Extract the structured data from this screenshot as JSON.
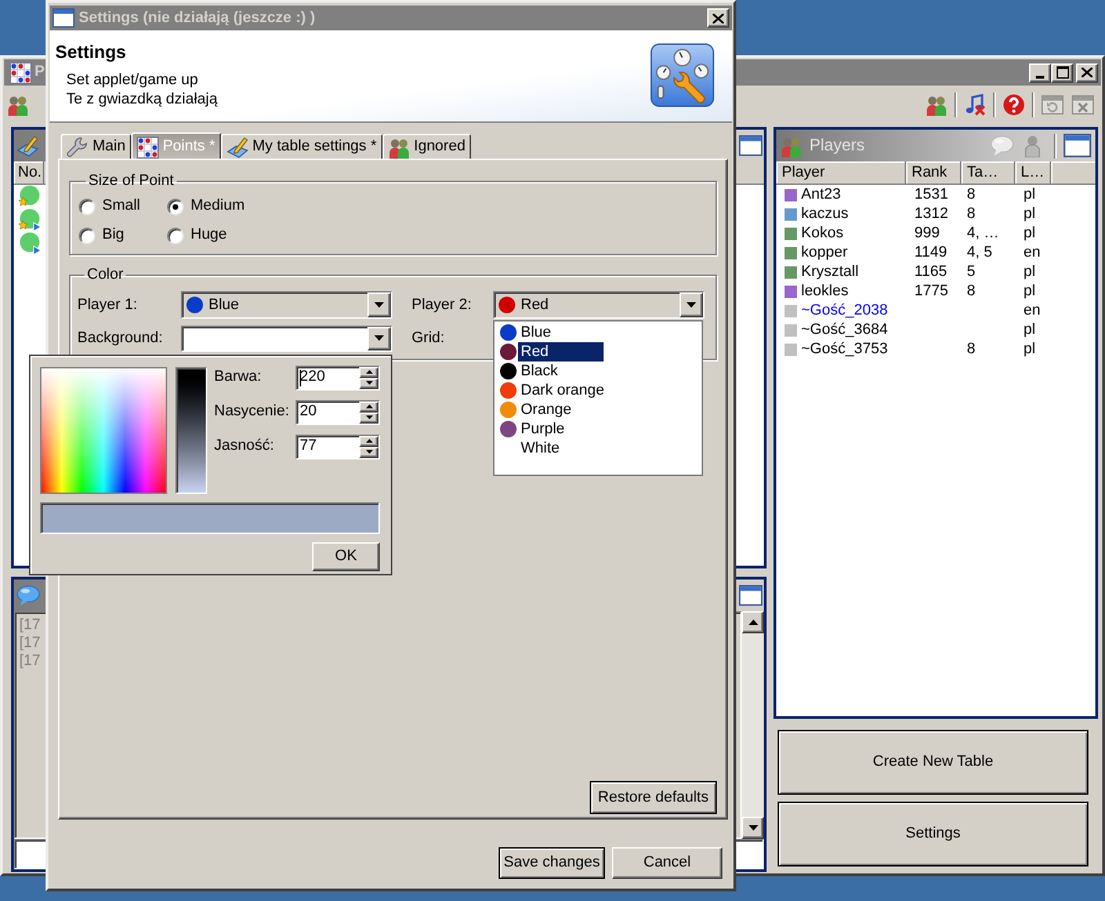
{
  "main_window": {
    "title": "P",
    "toolbar_left": [
      {
        "kind": "users",
        "disabled": false
      }
    ],
    "toolbar_right": [
      {
        "kind": "users",
        "disabled": false
      },
      {
        "kind": "sound",
        "disabled": false
      },
      {
        "kind": "help",
        "disabled": false
      },
      {
        "kind": "refresh",
        "disabled": true
      },
      {
        "kind": "close",
        "disabled": true
      }
    ]
  },
  "tables_panel": {
    "columns": [
      "No."
    ],
    "rows": [
      {
        "star_badge": true,
        "arrow_badge": false
      },
      {
        "star_badge": true,
        "arrow_badge": true
      },
      {
        "star_badge": false,
        "arrow_badge": true
      }
    ]
  },
  "chat_panel": {
    "disabled": true,
    "lines": [
      "[17",
      "[17",
      "[17"
    ]
  },
  "players_panel": {
    "title": "Players",
    "columns": [
      "Player",
      "Rank",
      "Ta…",
      "L…"
    ],
    "rows": [
      {
        "name": "Ant23",
        "rank": "1531",
        "tables": "8",
        "lang": "pl",
        "color": "#9966cc",
        "highlighted": false
      },
      {
        "name": "kaczus",
        "rank": "1312",
        "tables": "8",
        "lang": "pl",
        "color": "#6699cc",
        "highlighted": false
      },
      {
        "name": "Kokos",
        "rank": "999",
        "tables": "4, …",
        "lang": "pl",
        "color": "#669966",
        "highlighted": false
      },
      {
        "name": "kopper",
        "rank": "1149",
        "tables": "4, 5",
        "lang": "en",
        "color": "#669966",
        "highlighted": false
      },
      {
        "name": "Krysztall",
        "rank": "1165",
        "tables": "5",
        "lang": "pl",
        "color": "#669966",
        "highlighted": false
      },
      {
        "name": "leokles",
        "rank": "1775",
        "tables": "8",
        "lang": "pl",
        "color": "#9966cc",
        "highlighted": false
      },
      {
        "name": "~Gość_2038",
        "lang": "en",
        "color": "#c0c0c0",
        "highlighted": true
      },
      {
        "name": "~Gość_3684",
        "lang": "pl",
        "color": "#c0c0c0",
        "highlighted": false
      },
      {
        "name": "~Gość_3753",
        "tables": "8",
        "lang": "pl",
        "color": "#c0c0c0",
        "highlighted": false
      }
    ]
  },
  "side_buttons": [
    "Create New Table",
    "Settings"
  ],
  "dialog": {
    "title": "Settings (nie działają (jeszcze :) )",
    "heading": "Settings",
    "description": [
      "Set applet/game up",
      "Te z gwiazdką działają"
    ],
    "tabs": [
      {
        "label": "Main",
        "selected": false
      },
      {
        "label": "Points *",
        "selected": true
      },
      {
        "label": "My table settings *",
        "selected": false
      },
      {
        "label": "Ignored",
        "selected": false
      }
    ],
    "size_group": {
      "title": "Size of Point",
      "options": [
        {
          "label": "Small",
          "selected": false
        },
        {
          "label": "Medium",
          "selected": true
        },
        {
          "label": "Big",
          "selected": false
        },
        {
          "label": "Huge",
          "selected": false
        }
      ]
    },
    "color_group": {
      "title": "Color",
      "fields": [
        {
          "kind": "color_combo",
          "label": "Player 1:",
          "value": "Blue",
          "color": "#0a3cc8"
        },
        {
          "kind": "color_combo",
          "label": "Player 2:",
          "value": "Red",
          "color": "#d00000",
          "expanded": true,
          "options": [
            {
              "label": "Blue",
              "color": "#0a3cc8",
              "selected": false
            },
            {
              "label": "Red",
              "color": "#6b1a3a",
              "selected": true
            },
            {
              "label": "Black",
              "color": "#000000",
              "selected": false
            },
            {
              "label": "Dark orange",
              "color": "#f03c0a",
              "selected": false
            },
            {
              "label": "Orange",
              "color": "#f08c0a",
              "selected": false
            },
            {
              "label": "Purple",
              "color": "#7d4682",
              "selected": false
            },
            {
              "label": "White",
              "selected": false
            }
          ]
        },
        {
          "kind": "combo",
          "label": "Background:",
          "expanded": true,
          "picker": {
            "fields": [
              {
                "label": "Barwa:",
                "value": "220",
                "focused": true
              },
              {
                "label": "Nasycenie:",
                "value": "20",
                "focused": false
              },
              {
                "label": "Jasność:",
                "value": "77",
                "focused": false
              }
            ],
            "button": "OK"
          }
        },
        {
          "kind": "label",
          "label": "Grid:"
        }
      ]
    },
    "restore_button": "Restore defaults",
    "buttons": [
      "Save changes",
      "Cancel"
    ]
  }
}
